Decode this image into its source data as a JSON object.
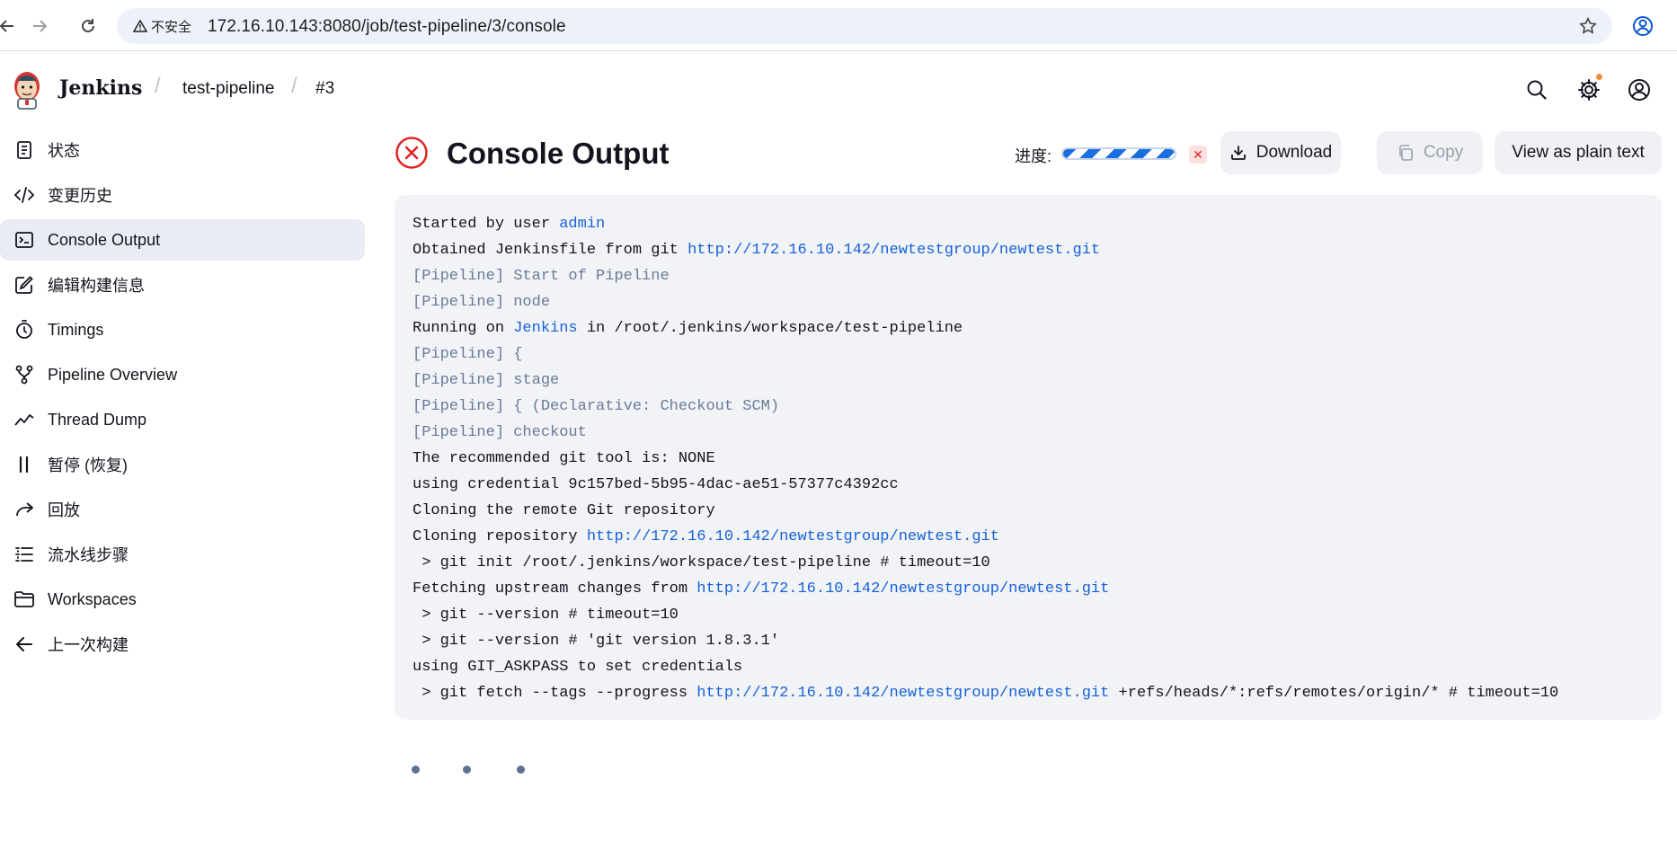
{
  "browser": {
    "security_label": "不安全",
    "url": "172.16.10.143:8080/job/test-pipeline/3/console"
  },
  "header": {
    "brand": "Jenkins",
    "breadcrumbs": [
      "test-pipeline",
      "#3"
    ]
  },
  "sidebar": {
    "items": [
      {
        "label": "状态",
        "icon": "notepad-icon"
      },
      {
        "label": "变更历史",
        "icon": "code-icon"
      },
      {
        "label": "Console Output",
        "icon": "terminal-icon",
        "active": true
      },
      {
        "label": "编辑构建信息",
        "icon": "edit-icon"
      },
      {
        "label": "Timings",
        "icon": "stopwatch-icon"
      },
      {
        "label": "Pipeline Overview",
        "icon": "branch-icon"
      },
      {
        "label": "Thread Dump",
        "icon": "trend-icon"
      },
      {
        "label": "暂停 (恢复)",
        "icon": "pause-icon"
      },
      {
        "label": "回放",
        "icon": "replay-icon"
      },
      {
        "label": "流水线步骤",
        "icon": "list-icon"
      },
      {
        "label": "Workspaces",
        "icon": "folder-icon"
      },
      {
        "label": "上一次构建",
        "icon": "arrow-left-icon"
      }
    ]
  },
  "main": {
    "title": "Console Output",
    "status": "failed",
    "progress_label": "进度:",
    "progress_percent": 100,
    "buttons": {
      "download": "Download",
      "copy": "Copy",
      "plain_text": "View as plain text"
    }
  },
  "console": {
    "lines": [
      [
        {
          "t": "Started by user "
        },
        {
          "t": "admin",
          "c": "link"
        }
      ],
      [
        {
          "t": "Obtained Jenkinsfile from git "
        },
        {
          "t": "http://172.16.10.142/newtestgroup/newtest.git",
          "c": "link"
        }
      ],
      [
        {
          "t": "[Pipeline] Start of Pipeline",
          "c": "pipe"
        }
      ],
      [
        {
          "t": "[Pipeline] node",
          "c": "pipe"
        }
      ],
      [
        {
          "t": "Running on "
        },
        {
          "t": "Jenkins",
          "c": "link"
        },
        {
          "t": " in /root/.jenkins/workspace/test-pipeline"
        }
      ],
      [
        {
          "t": "[Pipeline] {",
          "c": "pipe"
        }
      ],
      [
        {
          "t": "[Pipeline] stage",
          "c": "pipe"
        }
      ],
      [
        {
          "t": "[Pipeline] { (Declarative: Checkout SCM)",
          "c": "pipe"
        }
      ],
      [
        {
          "t": "[Pipeline] checkout",
          "c": "pipe"
        }
      ],
      [
        {
          "t": "The recommended git tool is: NONE"
        }
      ],
      [
        {
          "t": "using credential 9c157bed-5b95-4dac-ae51-57377c4392cc"
        }
      ],
      [
        {
          "t": "Cloning the remote Git repository"
        }
      ],
      [
        {
          "t": "Cloning repository "
        },
        {
          "t": "http://172.16.10.142/newtestgroup/newtest.git",
          "c": "link"
        }
      ],
      [
        {
          "t": " > git init /root/.jenkins/workspace/test-pipeline # timeout=10"
        }
      ],
      [
        {
          "t": "Fetching upstream changes from "
        },
        {
          "t": "http://172.16.10.142/newtestgroup/newtest.git",
          "c": "link"
        }
      ],
      [
        {
          "t": " > git --version # timeout=10"
        }
      ],
      [
        {
          "t": " > git --version # 'git version 1.8.3.1'"
        }
      ],
      [
        {
          "t": "using GIT_ASKPASS to set credentials"
        }
      ],
      [
        {
          "t": " > git fetch --tags --progress "
        },
        {
          "t": "http://172.16.10.142/newtestgroup/newtest.git",
          "c": "link"
        },
        {
          "t": " +refs/heads/*:refs/remotes/origin/* # timeout=10"
        }
      ]
    ]
  },
  "colors": {
    "link": "#1762d8",
    "pipeline_step": "#6a7a98",
    "failure": "#e02424",
    "progress": "#1a6fe0"
  }
}
